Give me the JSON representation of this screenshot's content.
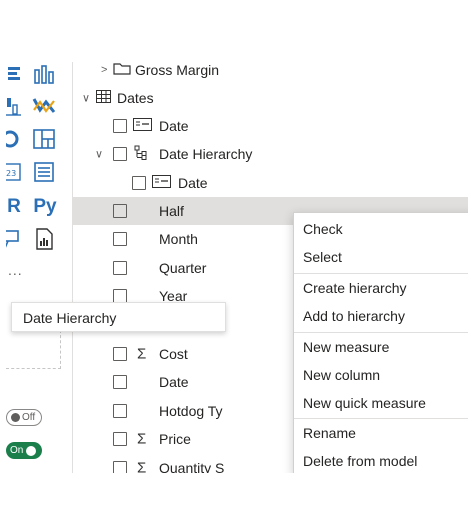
{
  "fields": {
    "gross_margin": "Gross Margin",
    "dates_table": "Dates",
    "date_field": "Date",
    "date_hierarchy": "Date Hierarchy",
    "hierarchy_date": "Date",
    "half": "Half",
    "month": "Month",
    "quarter": "Quarter",
    "year": "Year",
    "cost": "Cost",
    "date2": "Date",
    "hotdog_type": "Hotdog Ty",
    "price": "Price",
    "quantity": "Quantity S"
  },
  "tooltip": {
    "text": "Date Hierarchy"
  },
  "context_menu": {
    "check": "Check",
    "select": "Select",
    "create_hierarchy": "Create hierarchy",
    "add_to_hierarchy": "Add to hierarchy",
    "new_measure": "New measure",
    "new_column": "New column",
    "new_quick_measure": "New quick measure",
    "rename": "Rename",
    "delete_from_model": "Delete from model",
    "submenu_chevron": ">"
  },
  "visuals": {
    "r_visual": "R",
    "python_visual": "Py",
    "more": "...",
    "toggle_off": "Off",
    "toggle_on": "On"
  },
  "icons": {
    "expand_collapsed": "chevron-right-icon",
    "expand_open": "chevron-down-icon",
    "table": "table-icon",
    "field": "field-card-icon",
    "hierarchy": "hierarchy-icon",
    "measure": "sigma-icon"
  },
  "colors": {
    "accent": "#2b6fb6",
    "highlight": "#e1dfdd",
    "toggle_on": "#1b7f4c",
    "text": "#252423"
  }
}
